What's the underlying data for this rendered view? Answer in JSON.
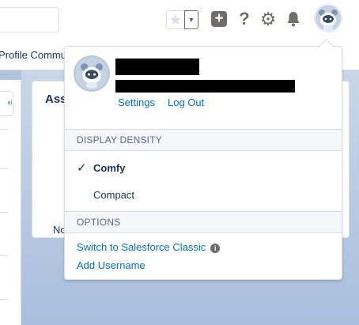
{
  "header": {
    "favorites_star": "★",
    "favorites_menu": "▼",
    "plus_glyph": "+",
    "help_glyph": "?",
    "gear_glyph": "⚙"
  },
  "nav": {
    "visible_text": "Profile Commu"
  },
  "card": {
    "title": "Ass",
    "empty_text": "No"
  },
  "left_panel": {
    "button_text": "al"
  },
  "user_menu": {
    "settings_label": "Settings",
    "logout_label": "Log Out",
    "density_header": "DISPLAY DENSITY",
    "density_options": [
      {
        "label": "Comfy",
        "selected": true
      },
      {
        "label": "Compact",
        "selected": false
      }
    ],
    "check_glyph": "✓",
    "options_header": "OPTIONS",
    "switch_classic_label": "Switch to Salesforce Classic",
    "info_glyph": "i",
    "add_username_label": "Add Username"
  },
  "colors": {
    "link": "#0070d2",
    "text": "#16325c",
    "section_bg": "#f4f6f9",
    "icon_gray": "#706e6b"
  }
}
